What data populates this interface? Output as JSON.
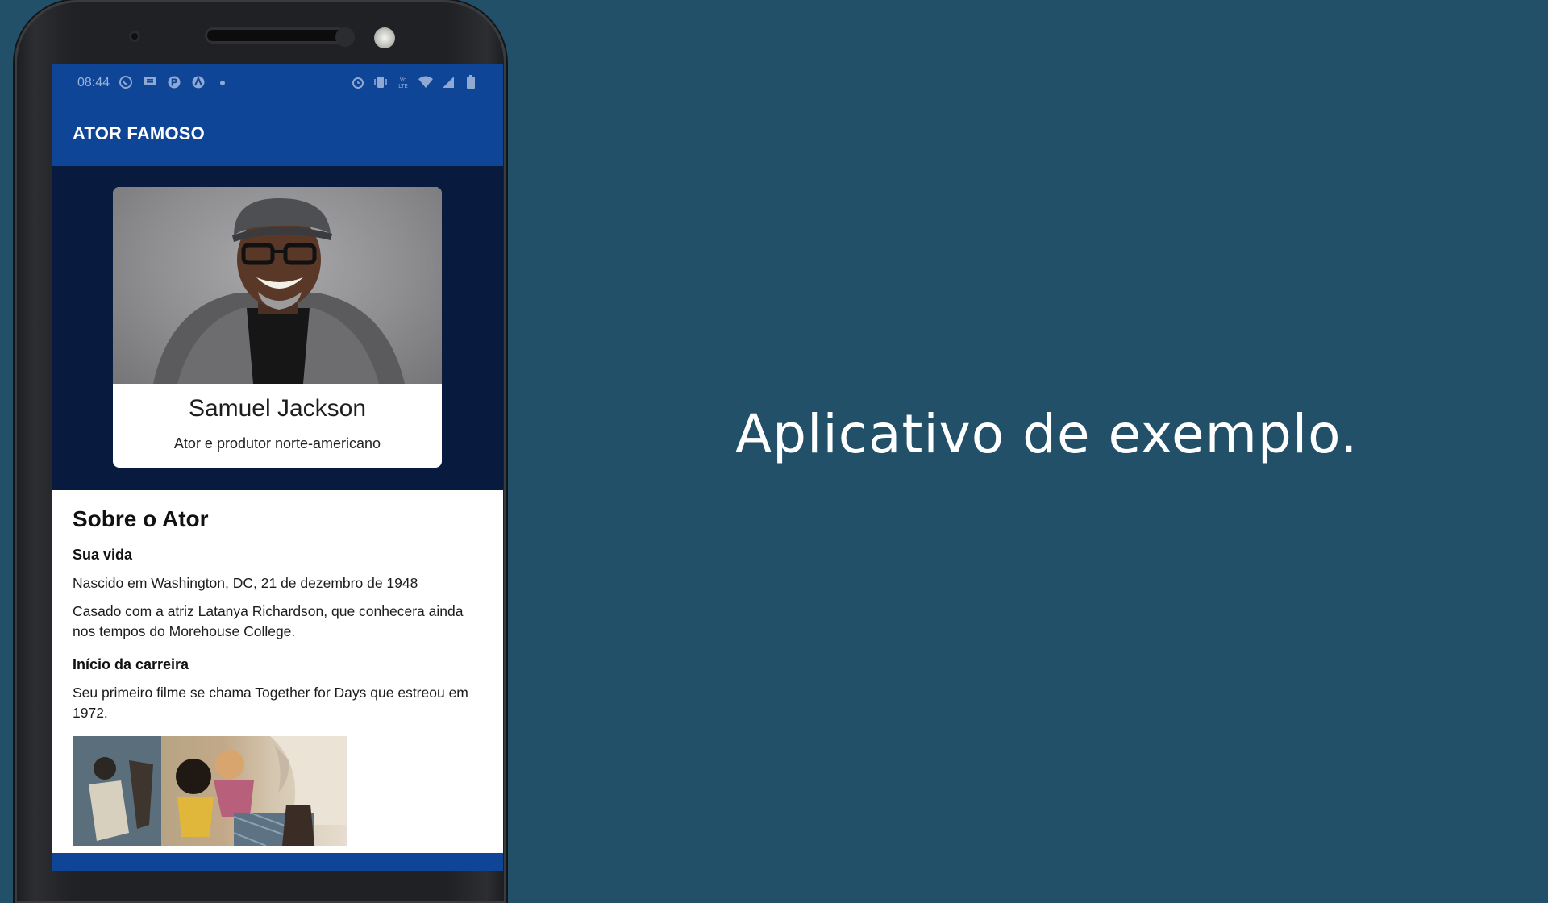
{
  "status_bar": {
    "time": "08:44",
    "left_icons": [
      "whatsapp-icon",
      "message-icon",
      "pinterest-icon",
      "angular-icon",
      "dot-icon"
    ],
    "right_icons": [
      "alarm-icon",
      "vibrate-icon",
      "volte-icon",
      "wifi-icon",
      "signal-icon",
      "battery-icon"
    ]
  },
  "app_bar": {
    "title": "ATOR FAMOSO"
  },
  "profile": {
    "name": "Samuel Jackson",
    "subtitle": "Ator e produtor norte-americano"
  },
  "about": {
    "heading": "Sobre o Ator",
    "life": {
      "heading": "Sua vida",
      "paragraphs": [
        "Nascido em Washington, DC, 21 de dezembro de 1948",
        "Casado com a atriz Latanya Richardson, que conhecera ainda nos tempos do Morehouse College."
      ]
    },
    "career": {
      "heading": "Início da carreira",
      "paragraphs": [
        "Seu primeiro filme se chama Together for Days que estreou em 1972."
      ]
    }
  },
  "headline": "Aplicativo de exemplo.",
  "colors": {
    "background": "#215068",
    "app_bar": "#0f4596",
    "hero": "#081a3e"
  }
}
